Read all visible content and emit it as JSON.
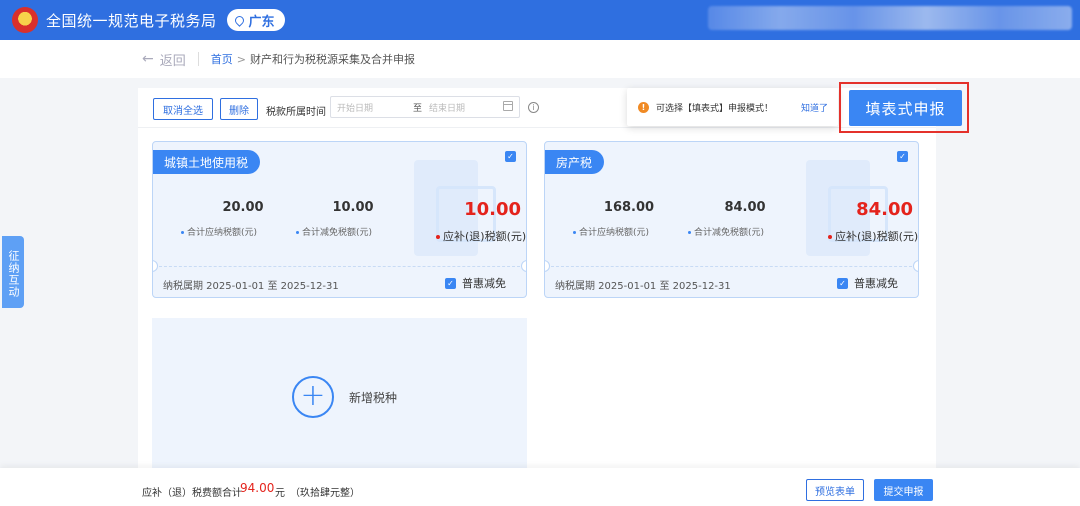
{
  "header": {
    "title": "全国统一规范电子税务局",
    "region": "广东"
  },
  "breadcrumb": {
    "back_label": "返回",
    "home": "首页",
    "separator": ">",
    "current": "财产和行为税税源采集及合并申报"
  },
  "side_tab": {
    "label": "征纳互动"
  },
  "toolbar": {
    "deselect_all": "取消全选",
    "delete": "删除",
    "period_label": "税款所属时间",
    "start_placeholder": "开始日期",
    "range_sep": "至",
    "end_placeholder": "结束日期"
  },
  "tooltip": {
    "text": "可选择【填表式】申报模式！",
    "ok": "知道了"
  },
  "form_button": "填表式申报",
  "cards": [
    {
      "name": "城镇土地使用税",
      "payable_value": "20.00",
      "payable_label": "合计应纳税额(元)",
      "relief_value": "10.00",
      "relief_label": "合计减免税额(元)",
      "net_value": "10.00",
      "net_label": "应补(退)税额(元)",
      "period": "纳税属期 2025-01-01 至 2025-12-31",
      "relief_checkbox": "普惠减免"
    },
    {
      "name": "房产税",
      "payable_value": "168.00",
      "payable_label": "合计应纳税额(元)",
      "relief_value": "84.00",
      "relief_label": "合计减免税额(元)",
      "net_value": "84.00",
      "net_label": "应补(退)税额(元)",
      "period": "纳税属期 2025-01-01 至 2025-12-31",
      "relief_checkbox": "普惠减免"
    }
  ],
  "add_tax": {
    "label": "新增税种"
  },
  "footer": {
    "total_label": "应补（退）税费额合计",
    "total_amount": "94.00",
    "unit": "元",
    "amount_words": "（玖拾肆元整）",
    "preview": "预览表单",
    "submit": "提交申报"
  },
  "colors": {
    "primary": "#2f6fe0",
    "button_blue": "#3a86f3",
    "amount_red": "#e4231c",
    "highlight_frame": "#e4312b",
    "tip_orange": "#f08a24"
  },
  "icons": {
    "region": "location-pin-icon",
    "tooltip": "exclamation-icon",
    "info": "info-icon",
    "calendar": "calendar-icon",
    "add": "plus-icon",
    "checkbox": "checkbox-checked-icon"
  }
}
